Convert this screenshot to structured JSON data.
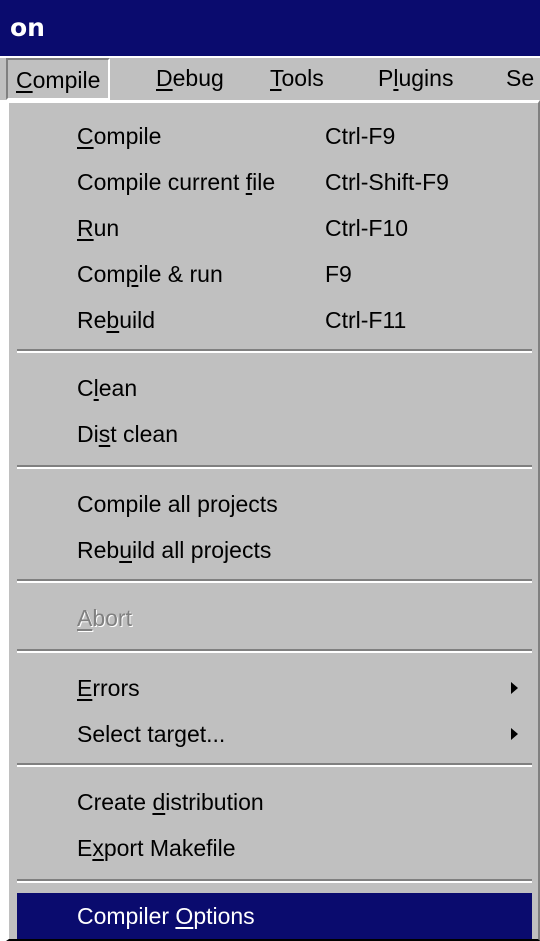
{
  "window": {
    "title": "on"
  },
  "menubar": {
    "items": [
      {
        "label_ul": "C",
        "label_rest": "ompile"
      },
      {
        "label_ul": "D",
        "label_rest": "ebug"
      },
      {
        "label_ul": "T",
        "label_rest": "ools"
      },
      {
        "label_pre": "P",
        "label_ul": "l",
        "label_rest": "ugins"
      },
      {
        "label_pre": "Se",
        "label_ul": "",
        "label_rest": ""
      }
    ]
  },
  "compile_menu": {
    "items": [
      {
        "pre": "",
        "ul": "C",
        "post": "ompile",
        "shortcut": "Ctrl-F9"
      },
      {
        "pre": "Compile current ",
        "ul": "f",
        "post": "ile",
        "shortcut": "Ctrl-Shift-F9"
      },
      {
        "pre": "",
        "ul": "R",
        "post": "un",
        "shortcut": "Ctrl-F10"
      },
      {
        "pre": "Com",
        "ul": "p",
        "post": "ile & run",
        "shortcut": "F9"
      },
      {
        "pre": "Re",
        "ul": "b",
        "post": "uild",
        "shortcut": "Ctrl-F11"
      },
      {
        "pre": "C",
        "ul": "l",
        "post": "ean"
      },
      {
        "pre": "Di",
        "ul": "s",
        "post": "t clean"
      },
      {
        "pre": "Compile all projects",
        "ul": "",
        "post": ""
      },
      {
        "pre": "Reb",
        "ul": "u",
        "post": "ild all projects"
      },
      {
        "pre": "",
        "ul": "A",
        "post": "bort",
        "disabled": true
      },
      {
        "pre": "",
        "ul": "E",
        "post": "rrors",
        "submenu": true
      },
      {
        "pre": "Select target...",
        "ul": "",
        "post": "",
        "submenu": true
      },
      {
        "pre": "Create ",
        "ul": "d",
        "post": "istribution"
      },
      {
        "pre": "E",
        "ul": "x",
        "post": "port Makefile"
      },
      {
        "pre": "Compiler ",
        "ul": "O",
        "post": "ptions",
        "selected": true
      }
    ]
  }
}
